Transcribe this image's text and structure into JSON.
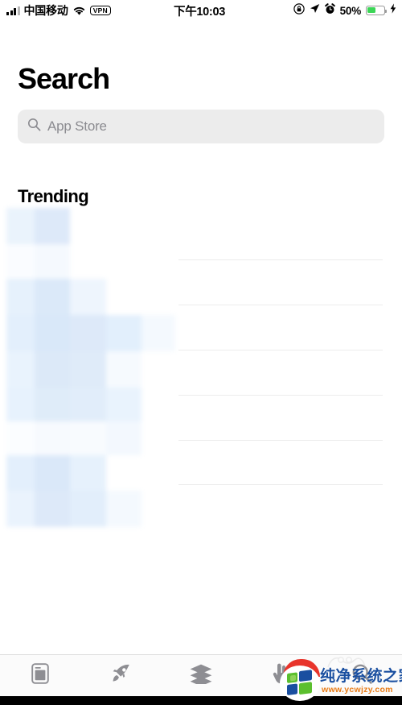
{
  "status_bar": {
    "carrier": "中国移动",
    "wifi_icon": "wifi-icon",
    "vpn_label": "VPN",
    "time": "下午10:03",
    "rotation_lock_icon": "rotation-lock-icon",
    "location_icon": "location-arrow-icon",
    "alarm_icon": "alarm-clock-icon",
    "battery_percent": "50%",
    "battery_fill_color": "#3cd657",
    "charging_icon": "lightning-bolt-icon"
  },
  "header": {
    "title": "Search"
  },
  "search": {
    "icon": "search-icon",
    "placeholder": "App Store",
    "value": "",
    "background_color": "#ececec"
  },
  "trending": {
    "heading": "Trending",
    "state": "loading",
    "skeleton_color": "#dce9f8",
    "separator_color": "#ececec",
    "separator_count": 6
  },
  "tab_bar": {
    "background_color": "#fbfbfb",
    "icon_color": "#8e8e93",
    "items": [
      {
        "name": "tab-today",
        "icon": "document-icon",
        "label": ""
      },
      {
        "name": "tab-games",
        "icon": "rocket-icon",
        "label": ""
      },
      {
        "name": "tab-apps",
        "icon": "layers-icon",
        "label": ""
      },
      {
        "name": "tab-arcade",
        "icon": "arcade-hand-icon",
        "label": ""
      },
      {
        "name": "tab-search",
        "icon": "search-icon",
        "label": ""
      }
    ]
  },
  "watermark": {
    "brand": "纯净系统之家",
    "url": "www.ycwjzy.com",
    "brand_color": "#1a4fa0",
    "url_color": "#e87b16",
    "accent_red": "#e8342b",
    "accent_green": "#5bbf2e"
  }
}
